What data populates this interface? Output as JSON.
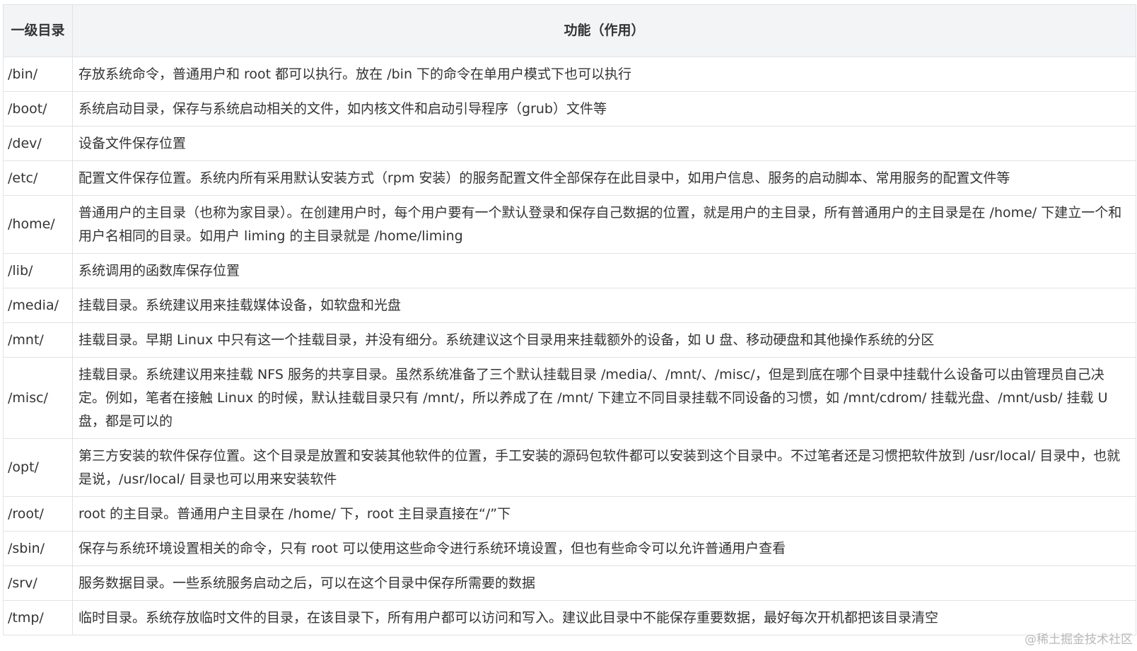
{
  "table": {
    "headers": [
      "一级目录",
      "功能（作用）"
    ],
    "rows": [
      {
        "dir": "/bin/",
        "desc": "存放系统命令，普通用户和 root 都可以执行。放在 /bin 下的命令在单用户模式下也可以执行"
      },
      {
        "dir": "/boot/",
        "desc": "系统启动目录，保存与系统启动相关的文件，如内核文件和启动引导程序（grub）文件等"
      },
      {
        "dir": "/dev/",
        "desc": "设备文件保存位置"
      },
      {
        "dir": "/etc/",
        "desc": "配置文件保存位置。系统内所有采用默认安装方式（rpm 安装）的服务配置文件全部保存在此目录中，如用户信息、服务的启动脚本、常用服务的配置文件等"
      },
      {
        "dir": "/home/",
        "desc": "普通用户的主目录（也称为家目录）。在创建用户时，每个用户要有一个默认登录和保存自己数据的位置，就是用户的主目录，所有普通用户的主目录是在 /home/ 下建立一个和用户名相同的目录。如用户 liming 的主目录就是 /home/liming"
      },
      {
        "dir": "/lib/",
        "desc": "系统调用的函数库保存位置"
      },
      {
        "dir": "/media/",
        "desc": "挂载目录。系统建议用来挂载媒体设备，如软盘和光盘"
      },
      {
        "dir": "/mnt/",
        "desc": "挂载目录。早期 Linux 中只有这一个挂载目录，并没有细分。系统建议这个目录用来挂载额外的设备，如 U 盘、移动硬盘和其他操作系统的分区"
      },
      {
        "dir": "/misc/",
        "desc": "挂载目录。系统建议用来挂载 NFS 服务的共享目录。虽然系统准备了三个默认挂载目录 /media/、/mnt/、/misc/，但是到底在哪个目录中挂载什么设备可以由管理员自己决定。例如，笔者在接触 Linux 的时候，默认挂载目录只有 /mnt/，所以养成了在 /mnt/ 下建立不同目录挂载不同设备的习惯，如 /mnt/cdrom/ 挂载光盘、/mnt/usb/ 挂载 U 盘，都是可以的"
      },
      {
        "dir": "/opt/",
        "desc": "第三方安装的软件保存位置。这个目录是放置和安装其他软件的位置，手工安装的源码包软件都可以安装到这个目录中。不过笔者还是习惯把软件放到 /usr/local/ 目录中，也就是说，/usr/local/ 目录也可以用来安装软件"
      },
      {
        "dir": "/root/",
        "desc": "root 的主目录。普通用户主目录在 /home/ 下，root 主目录直接在“/”下"
      },
      {
        "dir": "/sbin/",
        "desc": "保存与系统环境设置相关的命令，只有 root 可以使用这些命令进行系统环境设置，但也有些命令可以允许普通用户查看"
      },
      {
        "dir": "/srv/",
        "desc": "服务数据目录。一些系统服务启动之后，可以在这个目录中保存所需要的数据"
      },
      {
        "dir": "/tmp/",
        "desc": "临时目录。系统存放临时文件的目录，在该目录下，所有用户都可以访问和写入。建议此目录中不能保存重要数据，最好每次开机都把该目录清空"
      }
    ]
  },
  "watermark": "@稀土掘金技术社区"
}
